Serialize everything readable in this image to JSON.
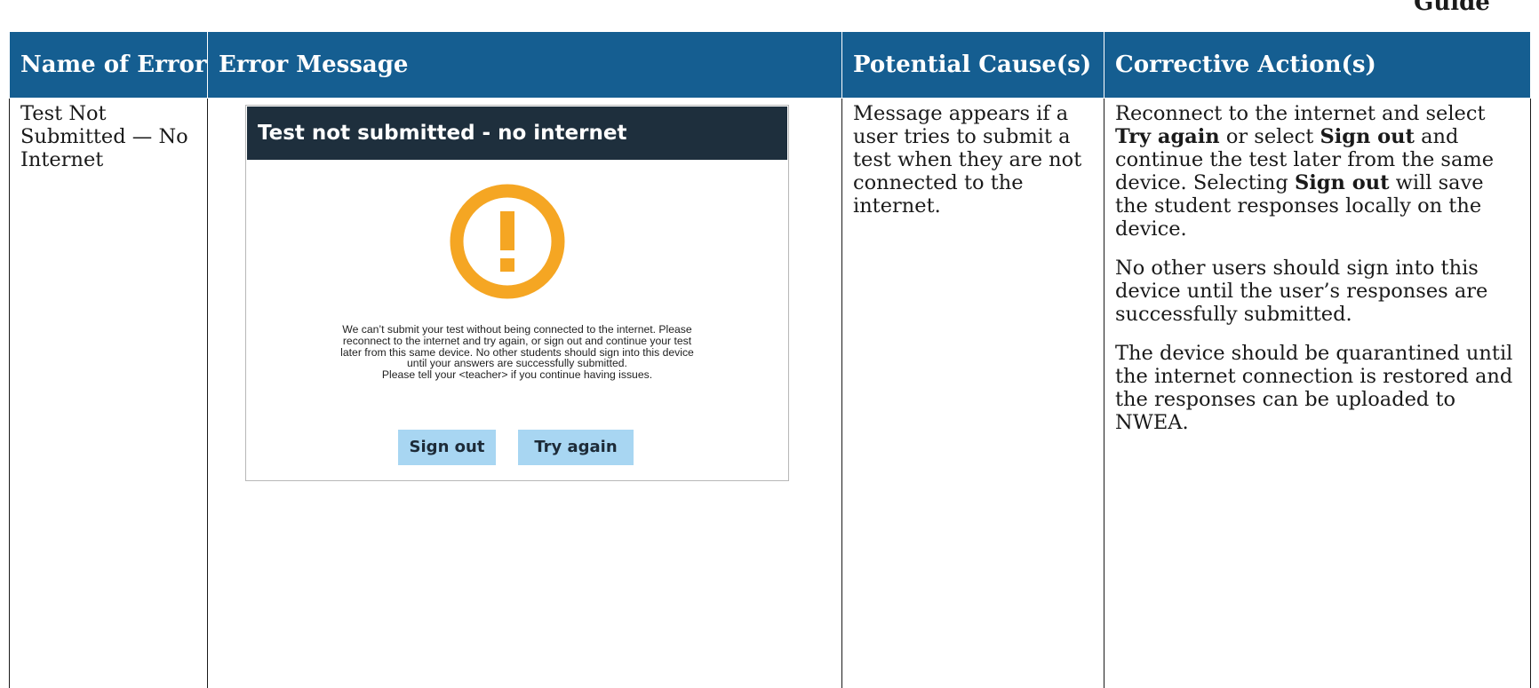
{
  "page_fragment": "Guide",
  "table": {
    "headers": [
      "Name of Error",
      "Error Message",
      "Potential Cause(s)",
      "Corrective Action(s)"
    ],
    "row": {
      "name": "Test Not Submitted — No Internet",
      "cause": "Message appears if a user tries to submit a test when they are not connected to the internet.",
      "actions": {
        "p1_a": "Reconnect to the internet and select ",
        "p1_b": "Try again",
        "p1_c": " or select ",
        "p1_d": "Sign out",
        "p1_e": " and continue the test later from the same device. Selecting ",
        "p1_f": "Sign out",
        "p1_g": " will save the student responses locally on the device.",
        "p2": "No other users should sign into this device until the user’s responses are successfully submitted.",
        "p3": "The device should be quarantined until the internet connection is restored and the responses can be uploaded to NWEA."
      }
    }
  },
  "dialog": {
    "title": "Test not submitted - no internet",
    "icon": "warning-icon",
    "icon_color": "#f5a623",
    "header_color": "#1e2f3d",
    "message_lines": [
      "We can’t submit your test without being connected to the internet. Please",
      "reconnect to the internet and try again, or sign out and continue your test",
      "later from this same device. No other students should sign into this device",
      "until your answers are successfully submitted.",
      "Please tell your <teacher> if you continue having issues."
    ],
    "sign_out_label": "Sign out",
    "try_again_label": "Try again",
    "button_color": "#a8d6f2"
  },
  "colors": {
    "header_bg": "#155e91"
  }
}
